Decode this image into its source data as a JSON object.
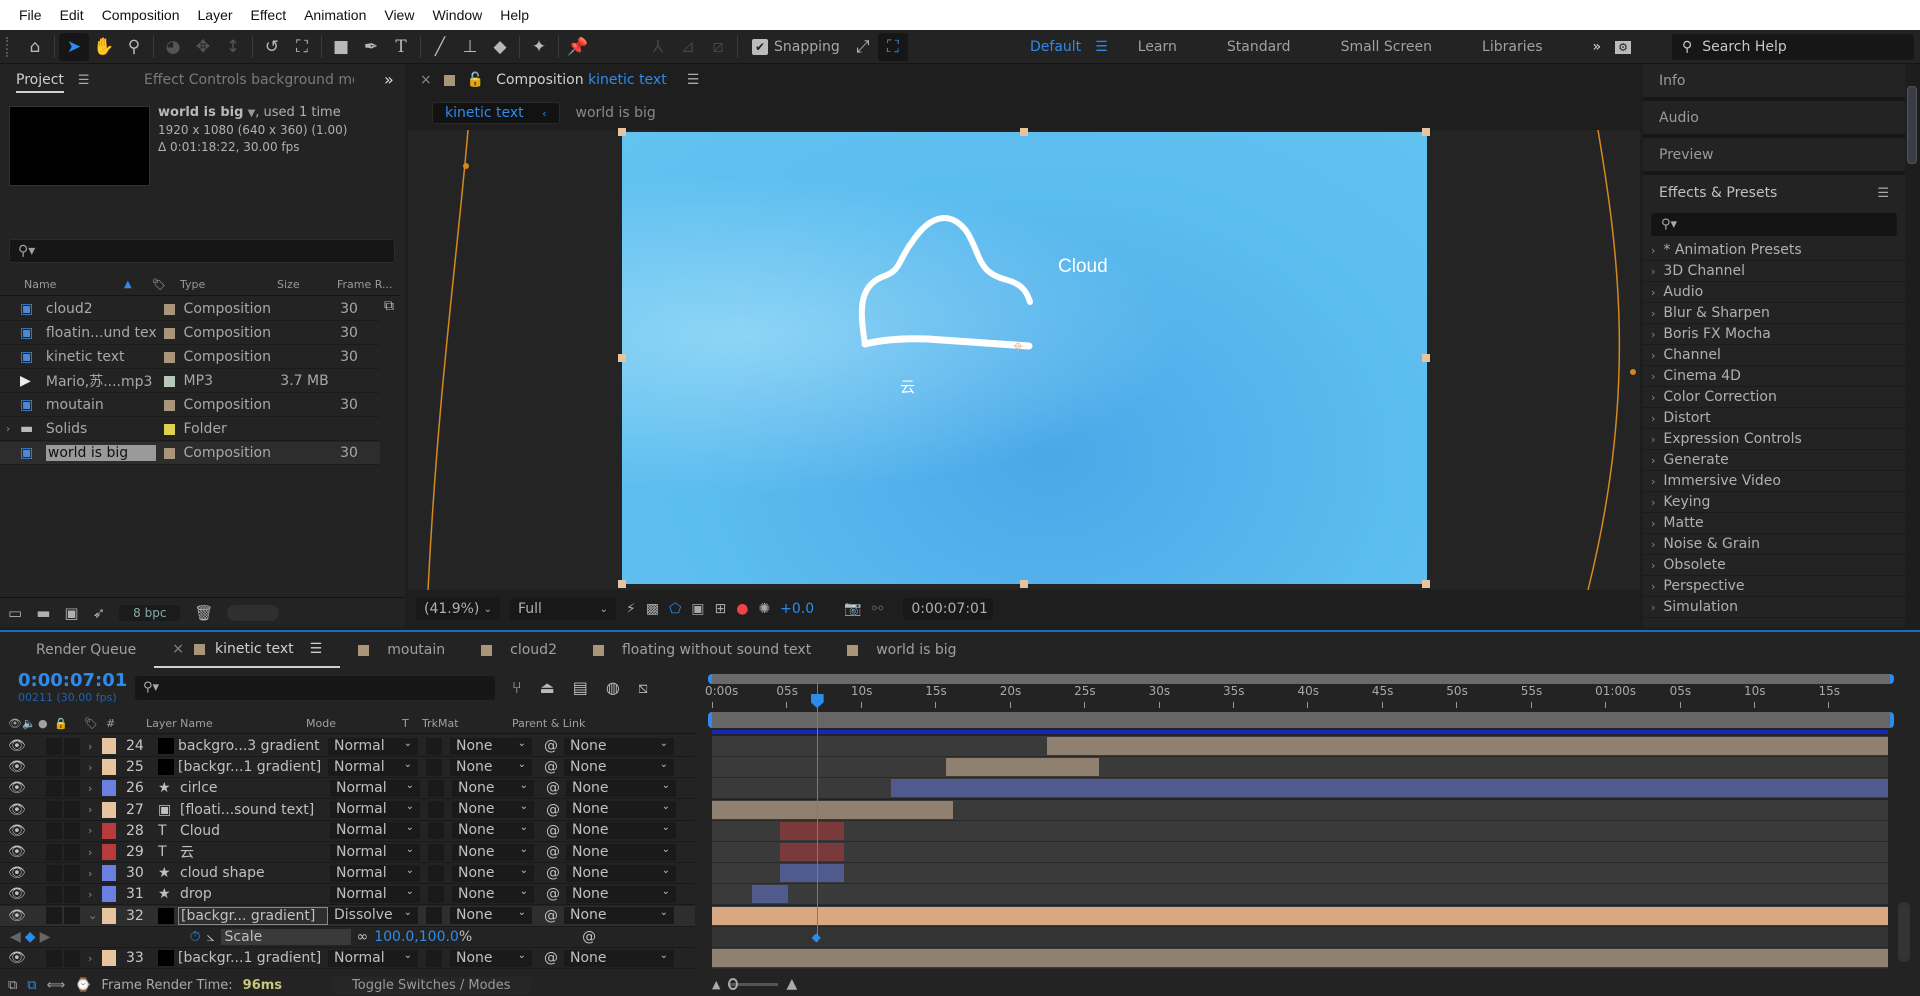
{
  "menu": [
    "File",
    "Edit",
    "Composition",
    "Layer",
    "Effect",
    "Animation",
    "View",
    "Window",
    "Help"
  ],
  "toolbar": {
    "tools": [
      "home-icon",
      "selection-icon",
      "hand-icon",
      "zoom-icon",
      "orbit-camera-icon",
      "pan-camera-icon",
      "dolly-camera-icon",
      "rotate-icon",
      "anchor-point-icon",
      "rectangle-icon",
      "pen-icon",
      "type-icon",
      "brush-icon",
      "clone-stamp-icon",
      "eraser-icon",
      "roto-brush-icon",
      "puppet-pin-icon"
    ],
    "snapping_label": "Snapping",
    "snapping_checked": true,
    "workspaces": [
      "Default",
      "Learn",
      "Standard",
      "Small Screen",
      "Libraries"
    ],
    "active_workspace": "Default",
    "search_placeholder": "Search Help"
  },
  "project": {
    "tab_label": "Project",
    "effect_controls_label": "Effect Controls background mov",
    "info": {
      "name": "world is big",
      "used": ", used 1 time",
      "resolution": "1920 x 1080  (640 x 360) (1.00)",
      "duration": "Δ 0:01:18:22, 30.00 fps"
    },
    "columns": [
      "Name",
      "Type",
      "Size",
      "Frame R..."
    ],
    "items": [
      {
        "name": "cloud2",
        "type": "Composition",
        "size": "",
        "fps": "30",
        "label": "#a8957a",
        "icon": "composition-icon"
      },
      {
        "name": "floatin...und text",
        "type": "Composition",
        "size": "",
        "fps": "30",
        "label": "#a8957a",
        "icon": "composition-icon"
      },
      {
        "name": "kinetic text",
        "type": "Composition",
        "size": "",
        "fps": "30",
        "label": "#a8957a",
        "icon": "composition-icon"
      },
      {
        "name": "Mario,苏....mp3",
        "type": "MP3",
        "size": "3.7 MB",
        "fps": "",
        "label": "#b8c8b8",
        "icon": "audio-file-icon"
      },
      {
        "name": "moutain",
        "type": "Composition",
        "size": "",
        "fps": "30",
        "label": "#a8957a",
        "icon": "composition-icon"
      },
      {
        "name": "Solids",
        "type": "Folder",
        "size": "",
        "fps": "",
        "label": "#e0d050",
        "icon": "folder-icon"
      },
      {
        "name": "world is big",
        "type": "Composition",
        "size": "",
        "fps": "30",
        "label": "#a8957a",
        "icon": "composition-icon",
        "selected": true
      }
    ],
    "bpc": "8 bpc"
  },
  "composition": {
    "tab_prefix": "Composition",
    "tab_name": "kinetic text",
    "breadcrumb": [
      "kinetic text",
      "world is big"
    ],
    "canvas_text": {
      "cloud": "Cloud",
      "yun": "云"
    },
    "magnification": "(41.9%)",
    "resolution": "Full",
    "exposure": "+0.0",
    "timecode": "0:00:07:01"
  },
  "right_panel": {
    "sections": [
      "Info",
      "Audio",
      "Preview"
    ],
    "effects_title": "Effects & Presets",
    "effects": [
      "* Animation Presets",
      "3D Channel",
      "Audio",
      "Blur & Sharpen",
      "Boris FX Mocha",
      "Channel",
      "Cinema 4D",
      "Color Correction",
      "Distort",
      "Expression Controls",
      "Generate",
      "Immersive Video",
      "Keying",
      "Matte",
      "Noise & Grain",
      "Obsolete",
      "Perspective",
      "Simulation"
    ]
  },
  "timeline": {
    "tabs": [
      {
        "label": "Render Queue"
      },
      {
        "label": "kinetic text",
        "active": true
      },
      {
        "label": "moutain"
      },
      {
        "label": "cloud2"
      },
      {
        "label": "floating without sound text"
      },
      {
        "label": "world is big"
      }
    ],
    "current_time": "0:00:07:01",
    "frame_info": "00211 (30.00 fps)",
    "columns": [
      "#",
      "Layer Name",
      "Mode",
      "T",
      "TrkMat",
      "Parent & Link"
    ],
    "ruler_ticks": [
      "0:00s",
      "05s",
      "10s",
      "15s",
      "20s",
      "25s",
      "30s",
      "35s",
      "40s",
      "45s",
      "50s",
      "55s",
      "01:00s",
      "05s",
      "10s",
      "15s"
    ],
    "duration_seconds": 79,
    "playhead_seconds": 7.03,
    "layers": [
      {
        "num": "24",
        "name": "backgro...3 gradient",
        "icon": "solid-icon",
        "label": "#e8c3a0",
        "mode": "Normal",
        "trkmat": "None",
        "parent": "None",
        "in": 22.5,
        "out": 79,
        "bar": "#8f8070"
      },
      {
        "num": "25",
        "name": "[backgr...1 gradient]",
        "icon": "solid-icon",
        "label": "#e8c3a0",
        "mode": "Normal",
        "trkmat": "None",
        "parent": "None",
        "in": 15.7,
        "out": 26,
        "bar": "#8f8070"
      },
      {
        "num": "26",
        "name": "cirlce",
        "icon": "shape-star-icon",
        "label": "#6a80e0",
        "mode": "Normal",
        "trkmat": "None",
        "parent": "None",
        "in": 12.0,
        "out": 79,
        "bar": "#505a8c"
      },
      {
        "num": "27",
        "name": "[floati...sound text]",
        "icon": "composition-icon",
        "label": "#e8c3a0",
        "mode": "Normal",
        "trkmat": "None",
        "parent": "None",
        "in": 0,
        "out": 16.2,
        "bar": "#8f8070"
      },
      {
        "num": "28",
        "name": "Cloud",
        "icon": "text-icon",
        "label": "#b83a3a",
        "mode": "Normal",
        "trkmat": "None",
        "parent": "None",
        "in": 4.6,
        "out": 8.9,
        "bar": "#7a3a3c"
      },
      {
        "num": "29",
        "name": "云",
        "icon": "text-icon",
        "label": "#b83a3a",
        "mode": "Normal",
        "trkmat": "None",
        "parent": "None",
        "in": 4.6,
        "out": 8.9,
        "bar": "#7a3a3c"
      },
      {
        "num": "30",
        "name": "cloud shape",
        "icon": "shape-star-icon",
        "label": "#6a80e0",
        "mode": "Normal",
        "trkmat": "None",
        "parent": "None",
        "in": 4.6,
        "out": 8.9,
        "bar": "#505a8c"
      },
      {
        "num": "31",
        "name": "drop",
        "icon": "shape-star-icon",
        "label": "#6a80e0",
        "mode": "Normal",
        "trkmat": "None",
        "parent": "None",
        "in": 2.7,
        "out": 5.1,
        "bar": "#505a8c"
      },
      {
        "num": "32",
        "name": "[backgr... gradient]",
        "icon": "solid-icon",
        "label": "#e8c3a0",
        "mode": "Dissolve",
        "trkmat": "None",
        "parent": "None",
        "in": 0,
        "out": 79,
        "bar": "#d8a882",
        "selected": true,
        "expanded": true
      },
      {
        "num": "33",
        "name": "[backgr...1 gradient]",
        "icon": "solid-icon",
        "label": "#e8c3a0",
        "mode": "Normal",
        "trkmat": "None",
        "parent": "None",
        "in": 0,
        "out": 79,
        "bar": "#8f8070"
      }
    ],
    "property": {
      "name": "Scale",
      "value": "100.0,100.0",
      "unit": "%",
      "keyframe_seconds": 7.03
    },
    "footer": {
      "render_label": "Frame Render Time:",
      "render_value": "96ms",
      "toggle_label": "Toggle Switches / Modes"
    }
  },
  "colors": {
    "accent": "#2d8ceb",
    "panel": "#232323",
    "bg": "#1d1d1d"
  }
}
